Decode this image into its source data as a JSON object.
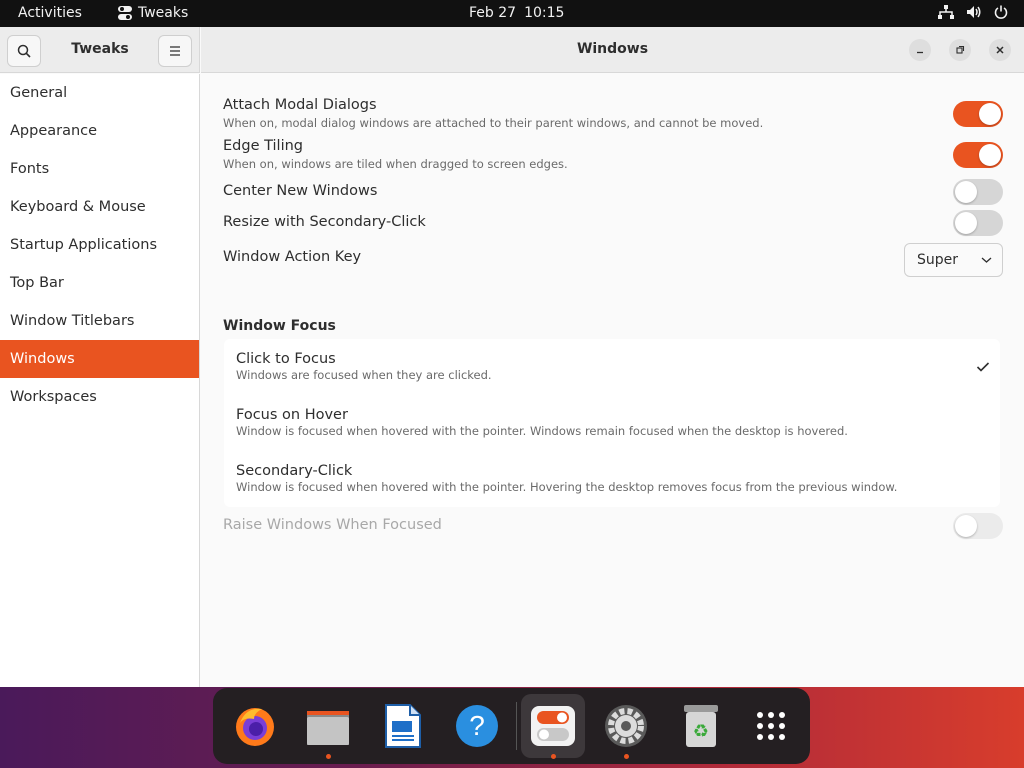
{
  "topbar": {
    "activities": "Activities",
    "app_name": "Tweaks",
    "date": "Feb 27",
    "time": "10:15",
    "icons": [
      "network-icon",
      "volume-icon",
      "power-icon"
    ]
  },
  "window": {
    "sidebar_title": "Tweaks",
    "title": "Windows",
    "accent_color": "#e95420"
  },
  "sidebar": {
    "items": [
      {
        "label": "General"
      },
      {
        "label": "Appearance"
      },
      {
        "label": "Fonts"
      },
      {
        "label": "Keyboard & Mouse"
      },
      {
        "label": "Startup Applications"
      },
      {
        "label": "Top Bar"
      },
      {
        "label": "Window Titlebars"
      },
      {
        "label": "Windows",
        "active": true
      },
      {
        "label": "Workspaces"
      }
    ]
  },
  "settings": {
    "attach_modal": {
      "label": "Attach Modal Dialogs",
      "desc": "When on, modal dialog windows are attached to their parent windows, and cannot be moved.",
      "enabled": true
    },
    "edge_tiling": {
      "label": "Edge Tiling",
      "desc": "When on, windows are tiled when dragged to screen edges.",
      "enabled": true
    },
    "center_new": {
      "label": "Center New Windows",
      "enabled": false
    },
    "resize_secondary": {
      "label": "Resize with Secondary-Click",
      "enabled": false
    },
    "action_key": {
      "label": "Window Action Key",
      "value": "Super"
    }
  },
  "window_focus": {
    "title": "Window Focus",
    "options": [
      {
        "label": "Click to Focus",
        "desc": "Windows are focused when they are clicked.",
        "selected": true
      },
      {
        "label": "Focus on Hover",
        "desc": "Window is focused when hovered with the pointer. Windows remain focused when the desktop is hovered.",
        "selected": false
      },
      {
        "label": "Secondary-Click",
        "desc": "Window is focused when hovered with the pointer. Hovering the desktop removes focus from the previous window.",
        "selected": false
      }
    ],
    "raise": {
      "label": "Raise Windows When Focused",
      "enabled": false,
      "disabled": true
    }
  },
  "dock": {
    "apps": [
      "firefox-icon",
      "files-icon",
      "libreoffice-writer-icon",
      "help-icon",
      "tweaks-icon",
      "settings-icon",
      "trash-icon",
      "show-apps-icon"
    ]
  }
}
